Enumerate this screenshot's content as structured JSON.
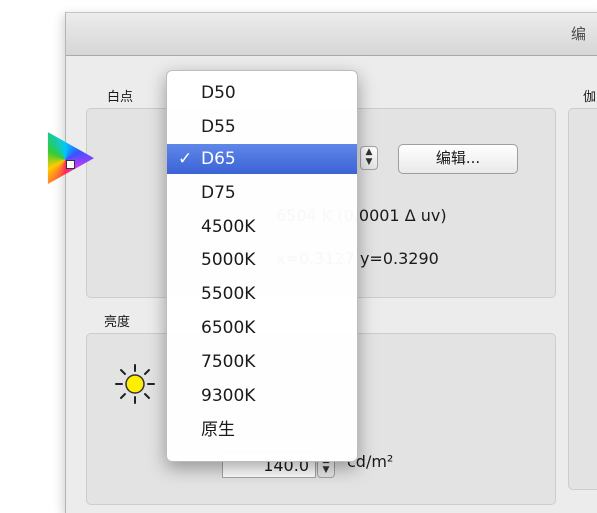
{
  "window": {
    "title": "编"
  },
  "white_point": {
    "label": "白点",
    "edit_button": "编辑...",
    "temperature_text": "6504 K (0.0001 Δ uv)",
    "chromaticity_text": "x=0.3127 y=0.3290",
    "selected": "D65",
    "options": [
      "D50",
      "D55",
      "D65",
      "D75",
      "4500K",
      "5000K",
      "5500K",
      "6500K",
      "7500K",
      "9300K",
      "原生"
    ]
  },
  "brightness": {
    "label": "亮度",
    "value": "140.0",
    "unit": "cd/m²"
  },
  "right_section": {
    "label": "伽"
  },
  "colors": {
    "menu_highlight": "#3b63d6",
    "sun": "#ffee00"
  },
  "icons": [
    "gamut-icon",
    "stepper-icon",
    "sun-icon",
    "checkmark-icon"
  ]
}
